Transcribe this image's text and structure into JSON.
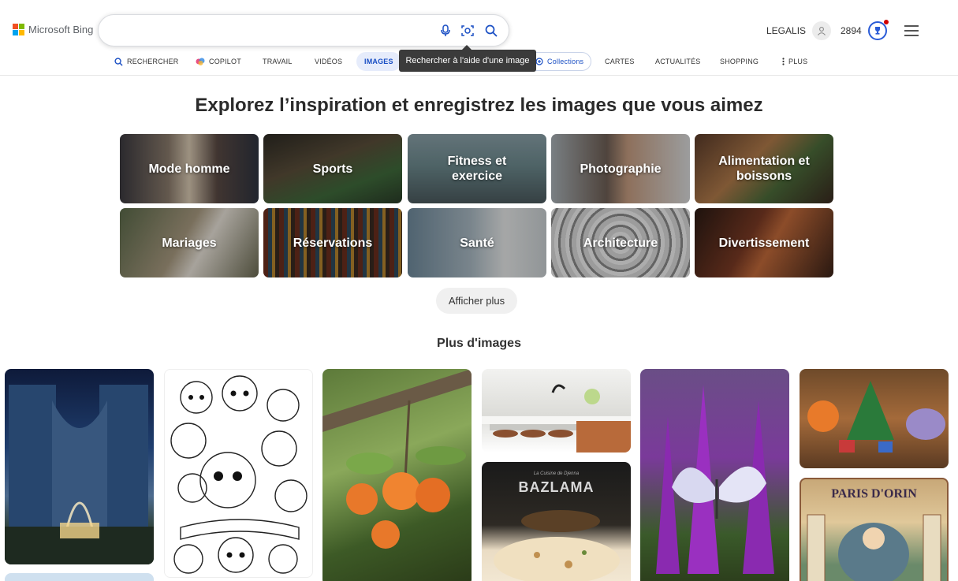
{
  "header": {
    "logo_text": "Microsoft Bing",
    "search": {
      "value": "",
      "placeholder": ""
    },
    "tooltip": "Rechercher à l'aide d'une image",
    "user_name": "LEGALIS",
    "points": "2894"
  },
  "nav": {
    "items": [
      {
        "label": "RECHERCHER",
        "icon": "search-icon"
      },
      {
        "label": "COPILOT",
        "icon": "copilot-icon"
      },
      {
        "label": "TRAVAIL"
      },
      {
        "label": "VIDÉOS"
      },
      {
        "label": "IMAGES",
        "active": true
      },
      {
        "label": "Collections",
        "icon": "collections-icon"
      },
      {
        "label": "CARTES"
      },
      {
        "label": "ACTUALITÉS"
      },
      {
        "label": "SHOPPING"
      },
      {
        "label": "PLUS",
        "icon": "more-vertical-icon"
      }
    ]
  },
  "main": {
    "headline": "Explorez l’inspiration et enregistrez les images que vous aimez",
    "categories": [
      {
        "label": "Mode homme"
      },
      {
        "label": "Sports"
      },
      {
        "label": "Fitness et exercice"
      },
      {
        "label": "Photographie"
      },
      {
        "label": "Alimentation et boissons"
      },
      {
        "label": "Mariages"
      },
      {
        "label": "Réservations"
      },
      {
        "label": "Santé"
      },
      {
        "label": "Architecture"
      },
      {
        "label": "Divertissement"
      }
    ],
    "show_more": "Afficher plus",
    "section_title": "Plus d'images",
    "gallery_texts": {
      "bazlama_title": "BAZLAMA",
      "bazlama_sub": "La Cuisine de Djenna",
      "poster_title": "PARIS D'ORIN"
    }
  },
  "colors": {
    "accent": "#1a4fc4",
    "tooltip_bg": "#3b3b3b",
    "logo_red": "#f25022",
    "logo_green": "#7fba00",
    "logo_blue": "#00a4ef",
    "logo_yellow": "#ffb900"
  }
}
